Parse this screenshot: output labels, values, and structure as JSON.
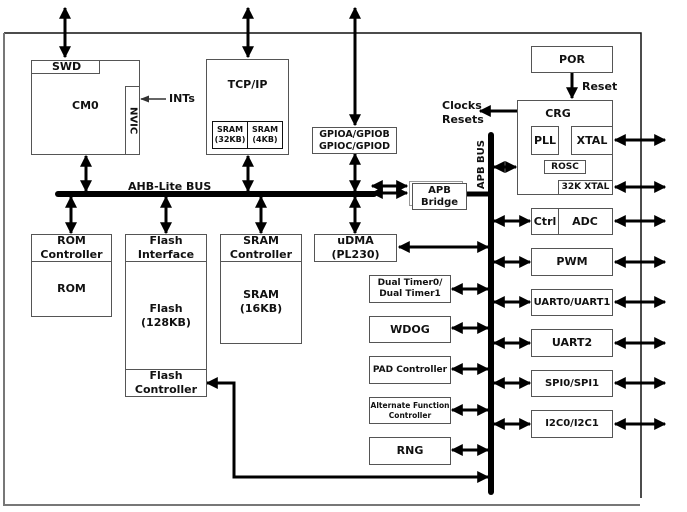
{
  "diagram": {
    "bus_labels": {
      "ahb": "AHB-Lite BUS",
      "apb": "APB BUS"
    },
    "signal_labels": {
      "ints": "INTs",
      "reset": "Reset",
      "clocks_resets": "Clocks\nResets"
    },
    "top_blocks": {
      "cm0": "CM0",
      "swd": "SWD",
      "nvic": "NVIC",
      "tcpip": "TCP/IP",
      "tcp_sram32": "SRAM\n(32KB)",
      "tcp_sram4": "SRAM\n(4KB)",
      "gpio": "GPIOA/GPIOB\nGPIOC/GPIOD",
      "apb_bridge": "APB\nBridge",
      "por": "POR",
      "crg": "CRG",
      "pll": "PLL",
      "xtal": "XTAL",
      "rosc": "ROSC",
      "xtal32k": "32K XTAL"
    },
    "memory_blocks": {
      "rom_controller": "ROM\nController",
      "rom": "ROM",
      "flash_interface": "Flash\nInterface",
      "flash": "Flash\n(128KB)",
      "flash_controller": "Flash\nController",
      "sram_controller": "SRAM\nController",
      "sram": "SRAM\n(16KB)",
      "udma": "uDMA\n(PL230)"
    },
    "apb_left_peripherals": [
      "Dual Timer0/\nDual Timer1",
      "WDOG",
      "PAD Controller",
      "Alternate Function\nController",
      "RNG"
    ],
    "apb_right_peripherals": {
      "adc_ctrl": "Ctrl",
      "adc": "ADC",
      "list": [
        "PWM",
        "UART0/UART1",
        "UART2",
        "SPI0/SPI1",
        "I2C0/I2C1"
      ]
    }
  }
}
